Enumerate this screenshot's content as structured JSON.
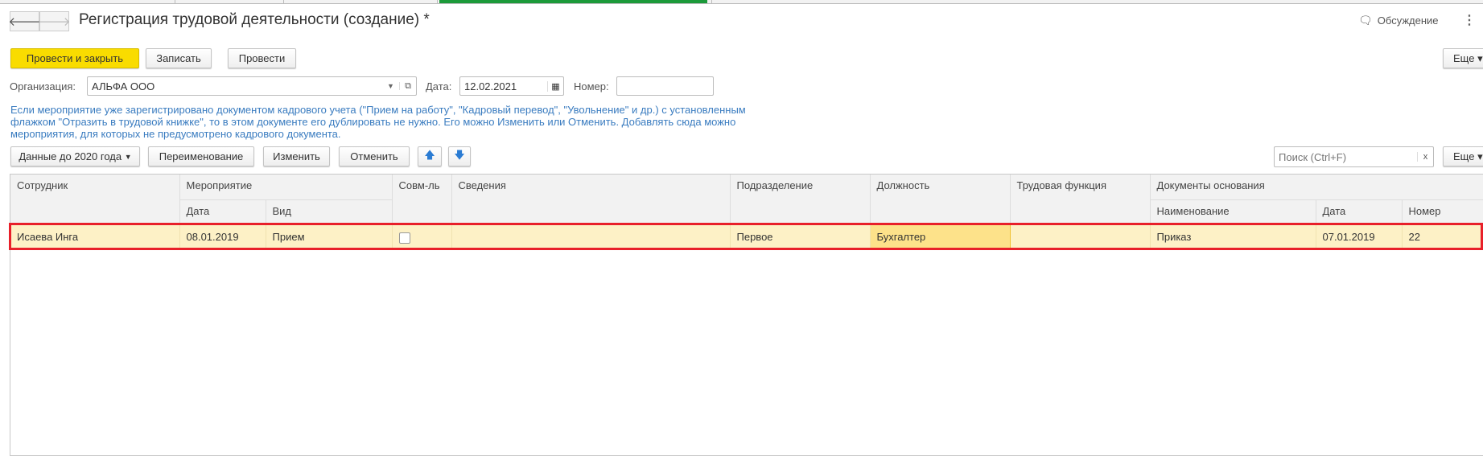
{
  "header": {
    "title": "Регистрация трудовой деятельности (создание) *",
    "discussion": "Обсуждение"
  },
  "toolbar": {
    "post_close": "Провести и закрыть",
    "save": "Записать",
    "post": "Провести",
    "more": "Еще"
  },
  "form": {
    "org_label": "Организация:",
    "org_value": "АЛЬФА ООО",
    "date_label": "Дата:",
    "date_value": "12.02.2021",
    "number_label": "Номер:",
    "number_value": ""
  },
  "info": "Если мероприятие уже зарегистрировано документом кадрового учета (\"Прием на работу\", \"Кадровый перевод\", \"Увольнение\" и др.) с установленным флажком \"Отразить в трудовой книжке\", то в этом документе его дублировать не нужно. Его можно Изменить или Отменить. Добавлять сюда можно мероприятия, для которых не предусмотрено кадрового документа.",
  "table_toolbar": {
    "data_before": "Данные до 2020 года",
    "rename": "Переименование",
    "change": "Изменить",
    "cancel": "Отменить",
    "search_placeholder": "Поиск (Ctrl+F)",
    "clear": "x",
    "more": "Еще"
  },
  "columns": {
    "employee": "Сотрудник",
    "event": "Мероприятие",
    "event_date": "Дата",
    "event_type": "Вид",
    "parttime": "Совм-ль",
    "info": "Сведения",
    "dept": "Подразделение",
    "position": "Должность",
    "function": "Трудовая функция",
    "docs": "Документы основания",
    "doc_name": "Наименование",
    "doc_date": "Дата",
    "doc_number": "Номер"
  },
  "rows": [
    {
      "employee": "Исаева Инга",
      "event_date": "08.01.2019",
      "event_type": "Прием",
      "parttime": false,
      "info": "",
      "dept": "Первое",
      "position": "Бухгалтер",
      "function": "",
      "doc_name": "Приказ",
      "doc_date": "07.01.2019",
      "doc_number": "22"
    }
  ]
}
